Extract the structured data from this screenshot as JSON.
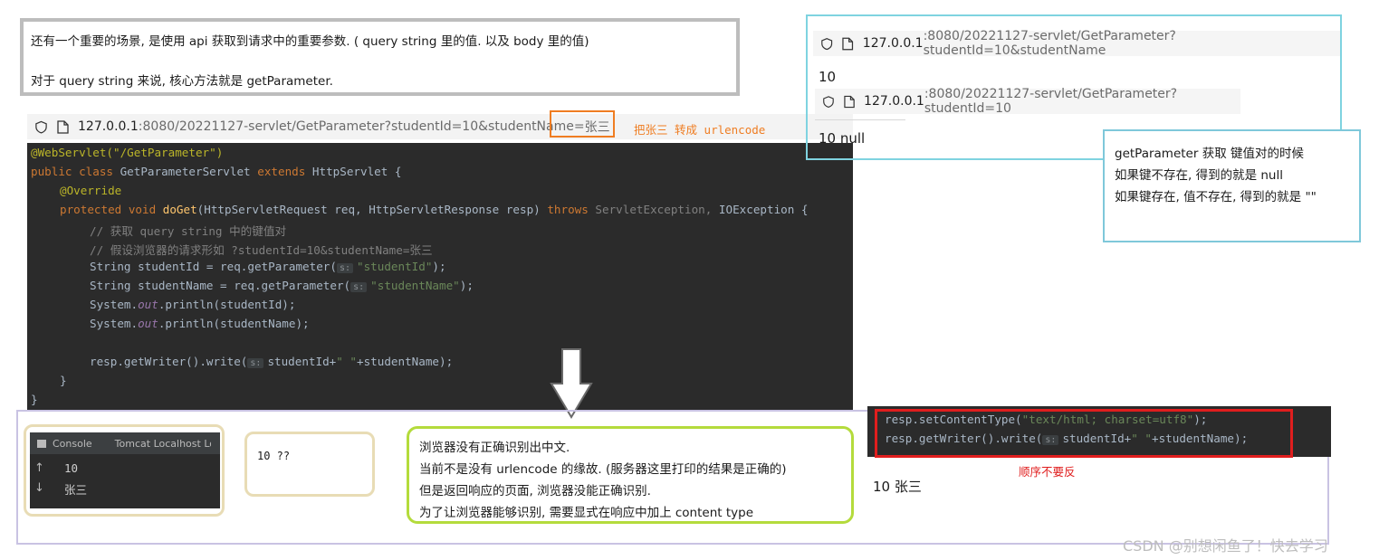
{
  "intro": {
    "line1": "还有一个重要的场景, 是使用 api 获取到请求中的重要参数. ( query string 里的值. 以及 body 里的值)",
    "line2": "对于 query string 来说, 核心方法就是 getParameter."
  },
  "main_url": {
    "host": "127.0.0.1",
    "rest": ":8080/20221127-servlet/GetParameter?studentId=10&studentName=",
    "highlight": "张三"
  },
  "annotation_urlencode": "把张三 转成 urlencode",
  "code": {
    "l1": "@WebServlet(\"/GetParameter\")",
    "l2a": "public class ",
    "l2b": "GetParameterServlet ",
    "l2c": "extends ",
    "l2d": "HttpServlet {",
    "l3": "@Override",
    "l4a": "protected void ",
    "l4b": "doGet",
    "l4c": "(HttpServletRequest req, HttpServletResponse resp) ",
    "l4d": "throws ",
    "l4e": "ServletException, ",
    "l4f": "IOException {",
    "l5": "// 获取 query string 中的键值对",
    "l6": "// 假设浏览器的请求形如 ?studentId=10&studentName=张三",
    "l7a": "String studentId = req.getParameter(",
    "hint": "s:",
    "l7b": "\"studentId\"",
    "l7c": ");",
    "l8a": "String studentName = req.getParameter(",
    "l8b": "\"studentName\"",
    "l8c": ");",
    "l9a": "System.",
    "out": "out",
    "l9b": ".println(studentId);",
    "l10b": ".println(studentName);",
    "l11a": "resp.getWriter().write(",
    "l11b": "studentId+",
    "l11c": "\" \"",
    "l11d": "+studentName);",
    "l12": "}",
    "l13": "}"
  },
  "right_browser": {
    "url1_host": "127.0.0.1",
    "url1_rest": ":8080/20221127-servlet/GetParameter?studentId=10&studentName",
    "result1": "10",
    "url2_host": "127.0.0.1",
    "url2_rest": ":8080/20221127-servlet/GetParameter?studentId=10",
    "result2": "10 null"
  },
  "tip": {
    "line1": "getParameter 获取 键值对的时候",
    "line2": "如果键不存在, 得到的就是 null",
    "line3": "如果键存在, 值不存在, 得到的就是 \"\""
  },
  "console": {
    "tab1": "Console",
    "tab2": "Tomcat Localhost Log",
    "out1": "10",
    "out2": "张三"
  },
  "browser_output": "10 ??",
  "note": {
    "line1": "浏览器没有正确识别出中文.",
    "line2": "当前不是没有  urlencode 的缘故. (服务器这里打印的结果是正确的)",
    "line3": "但是返回响应的页面, 浏览器没能正确识别.",
    "line4": "为了让浏览器能够识别, 需要显式在响应中加上 content type"
  },
  "code2": {
    "l1a": "resp.setContentType(",
    "l1b": "\"text/html; charset=utf8\"",
    "l1c": ");",
    "l2a": "resp.getWriter().write(",
    "hint": "s:",
    "l2b": "studentId+",
    "l2c": "\" \"",
    "l2d": "+studentName);"
  },
  "order_note": "顺序不要反",
  "final_output": "10 张三",
  "watermark": "CSDN @别想闲鱼了！快去学习",
  "colors": {
    "accent_orange": "#ef7d22",
    "red_box": "#e01e1e",
    "note_border": "#b4db3c",
    "cyan_border": "#7fd3e0"
  }
}
